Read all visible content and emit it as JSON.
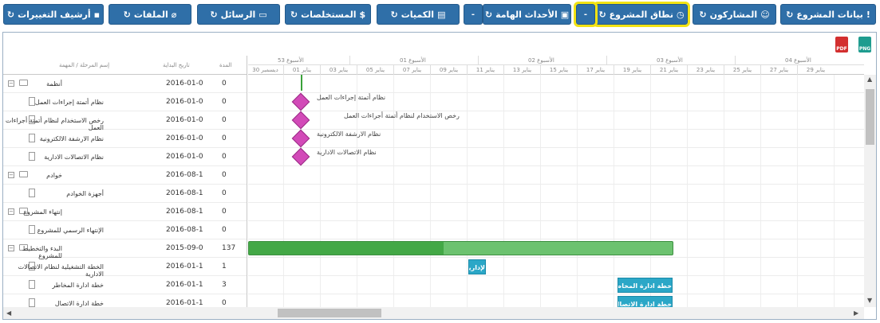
{
  "toolbar": {
    "buttons": [
      {
        "label": "بيانات المشروع",
        "icon": "!"
      },
      {
        "label": "المشاركون",
        "icon": "☺"
      },
      {
        "label": "نطاق المشروع",
        "icon": "◷"
      },
      {
        "label": "الأحداث الهامة",
        "icon": "▣"
      },
      {
        "label": "الكميات",
        "icon": "▤"
      },
      {
        "label": "المستخلصات",
        "icon": "$"
      },
      {
        "label": "الرسائل",
        "icon": "▭"
      },
      {
        "label": "الملفات",
        "icon": "⌀"
      },
      {
        "label": "أرشيف التغييرات",
        "icon": "▪"
      }
    ],
    "refresh_glyph": "↻",
    "caret_glyph": "-"
  },
  "export": {
    "pdf": "PDF",
    "png": "PNG"
  },
  "columns": {
    "name": "إسم المرحلة / المهمة",
    "start": "تاريخ البداية",
    "duration": "المدة"
  },
  "rows": [
    {
      "name": "أنظمة",
      "start": "2016-01-0",
      "duration": "0",
      "level": 0
    },
    {
      "name": "نظام أتمتة إجراءات العمل",
      "start": "2016-01-0",
      "duration": "0",
      "level": 1
    },
    {
      "name": "رخص الاستخدام لنظام أتمتة أجراءات العمل",
      "start": "2016-01-0",
      "duration": "0",
      "level": 1
    },
    {
      "name": "نظام الارشفة الالكترونية",
      "start": "2016-01-0",
      "duration": "0",
      "level": 1
    },
    {
      "name": "نظام الاتصالات الادارية",
      "start": "2016-01-0",
      "duration": "0",
      "level": 1
    },
    {
      "name": "خوادم",
      "start": "2016-08-1",
      "duration": "0",
      "level": 0
    },
    {
      "name": "أجهزة الخوادم",
      "start": "2016-08-1",
      "duration": "0",
      "level": 1
    },
    {
      "name": "إنتهاء المشروع",
      "start": "2016-08-1",
      "duration": "0",
      "level": 0
    },
    {
      "name": "الإنتهاء الرسمي للمشروع",
      "start": "2016-08-1",
      "duration": "0",
      "level": 1
    },
    {
      "name": "البدء والتخطيط للمشروع",
      "start": "2015-09-0",
      "duration": "137",
      "level": 0
    },
    {
      "name": "الخطة التشغيلية لنظام الاتصالات الادارية",
      "start": "2016-01-1",
      "duration": "1",
      "level": 1
    },
    {
      "name": "خطة ادارة المخاطر",
      "start": "2016-01-1",
      "duration": "3",
      "level": 1
    },
    {
      "name": "خطة ادارة الاتصال",
      "start": "2016-01-1",
      "duration": "0",
      "level": 1
    }
  ],
  "timeline": {
    "weeks": [
      "الأسبوع 53",
      "الأسبوع 01",
      "الأسبوع 02",
      "الأسبوع 03",
      "الأسبوع 04"
    ],
    "days": [
      "ديسمبر 30",
      "يناير 01",
      "يناير 03",
      "يناير 05",
      "يناير 07",
      "يناير 09",
      "يناير 11",
      "يناير 13",
      "يناير 15",
      "يناير 17",
      "يناير 19",
      "يناير 21",
      "يناير 23",
      "يناير 25",
      "يناير 27",
      "يناير 29"
    ],
    "day_prefix": "ديسمبر"
  },
  "gantt": {
    "milestone_labels": [
      "نظام أتمتة إجراءات العمل",
      "رخص الاستخدام لنظام أتمتة أجراءات العمل",
      "نظام الارشفة الالكترونية",
      "نظام الاتصالات الادارية"
    ],
    "bar_labels": [
      "لإدارية",
      "خطة ادارة المخاطر",
      "خطة ادارة الاتصال"
    ],
    "summary_progress": 0.46
  },
  "colors": {
    "accent": "#2f6fa8",
    "highlight": "#f2e313",
    "milestone": "#d24ab8",
    "summary": "#4caf50",
    "task": "#2ba7c7",
    "pdf": "#d32f2f",
    "png": "#1e9c8f"
  }
}
